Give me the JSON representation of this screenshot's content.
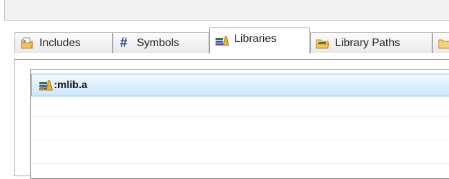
{
  "tabs": [
    {
      "label": "Includes",
      "icon": "includes-icon",
      "active": false
    },
    {
      "label": "Symbols",
      "icon": "hash-icon",
      "active": false
    },
    {
      "label": "Libraries",
      "icon": "libraries-icon",
      "active": true
    },
    {
      "label": "Library Paths",
      "icon": "library-paths-icon",
      "active": false
    }
  ],
  "library_list": {
    "items": [
      {
        "label": ":mlib.a",
        "icon": "library-file-icon",
        "selected": true
      }
    ]
  },
  "colors": {
    "selection_top": "#f1f8fe",
    "selection_bottom": "#cde6fb",
    "selection_border": "#7eb4ea",
    "tab_border": "#a9a9a9"
  }
}
